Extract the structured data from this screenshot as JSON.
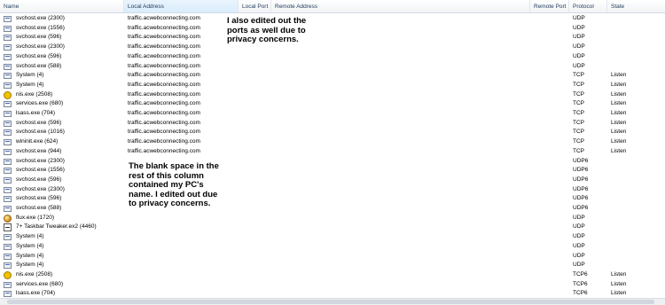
{
  "headers": {
    "name": "Name",
    "local_address": "Local Address",
    "local_port": "Local Port",
    "remote_address": "Remote Address",
    "remote_port": "Remote Port",
    "protocol": "Protocol",
    "state": "State"
  },
  "rows": [
    {
      "icon": "generic",
      "name": "svchost.exe (2300)",
      "addr": "traffic.acwebconnecting.com",
      "proto": "UDP",
      "state": ""
    },
    {
      "icon": "generic",
      "name": "svchost.exe (1556)",
      "addr": "traffic.acwebconnecting.com",
      "proto": "UDP",
      "state": ""
    },
    {
      "icon": "generic",
      "name": "svchost.exe (596)",
      "addr": "traffic.acwebconnecting.com",
      "proto": "UDP",
      "state": ""
    },
    {
      "icon": "generic",
      "name": "svchost.exe (2300)",
      "addr": "traffic.acwebconnecting.com",
      "proto": "UDP",
      "state": ""
    },
    {
      "icon": "generic",
      "name": "svchost.exe (596)",
      "addr": "traffic.acwebconnecting.com",
      "proto": "UDP",
      "state": ""
    },
    {
      "icon": "generic",
      "name": "svchost.exe (588)",
      "addr": "traffic.acwebconnecting.com",
      "proto": "UDP",
      "state": ""
    },
    {
      "icon": "generic",
      "name": "System (4)",
      "addr": "traffic.acwebconnecting.com",
      "proto": "TCP",
      "state": "Listen"
    },
    {
      "icon": "generic",
      "name": "System (4)",
      "addr": "traffic.acwebconnecting.com",
      "proto": "TCP",
      "state": "Listen"
    },
    {
      "icon": "nis",
      "name": "nis.exe (2508)",
      "addr": "traffic.acwebconnecting.com",
      "proto": "TCP",
      "state": "Listen"
    },
    {
      "icon": "generic",
      "name": "services.exe (680)",
      "addr": "traffic.acwebconnecting.com",
      "proto": "TCP",
      "state": "Listen"
    },
    {
      "icon": "generic",
      "name": "lsass.exe (704)",
      "addr": "traffic.acwebconnecting.com",
      "proto": "TCP",
      "state": "Listen"
    },
    {
      "icon": "generic",
      "name": "svchost.exe (596)",
      "addr": "traffic.acwebconnecting.com",
      "proto": "TCP",
      "state": "Listen"
    },
    {
      "icon": "generic",
      "name": "svchost.exe (1016)",
      "addr": "traffic.acwebconnecting.com",
      "proto": "TCP",
      "state": "Listen"
    },
    {
      "icon": "generic",
      "name": "wininit.exe (624)",
      "addr": "traffic.acwebconnecting.com",
      "proto": "TCP",
      "state": "Listen"
    },
    {
      "icon": "generic",
      "name": "svchost.exe (944)",
      "addr": "traffic.acwebconnecting.com",
      "proto": "TCP",
      "state": "Listen"
    },
    {
      "icon": "generic",
      "name": "svchost.exe (2300)",
      "addr": "",
      "proto": "UDP6",
      "state": ""
    },
    {
      "icon": "generic",
      "name": "svchost.exe (1556)",
      "addr": "",
      "proto": "UDP6",
      "state": ""
    },
    {
      "icon": "generic",
      "name": "svchost.exe (596)",
      "addr": "",
      "proto": "UDP6",
      "state": ""
    },
    {
      "icon": "generic",
      "name": "svchost.exe (2300)",
      "addr": "",
      "proto": "UDP6",
      "state": ""
    },
    {
      "icon": "generic",
      "name": "svchost.exe (596)",
      "addr": "",
      "proto": "UDP6",
      "state": ""
    },
    {
      "icon": "generic",
      "name": "svchost.exe (588)",
      "addr": "",
      "proto": "UDP6",
      "state": ""
    },
    {
      "icon": "flux",
      "name": "flux.exe (1720)",
      "addr": "",
      "proto": "UDP",
      "state": ""
    },
    {
      "icon": "tweaker",
      "name": "7+ Taskbar Tweaker.ex2 (4460)",
      "addr": "",
      "proto": "UDP",
      "state": ""
    },
    {
      "icon": "generic",
      "name": "System (4)",
      "addr": "",
      "proto": "UDP",
      "state": ""
    },
    {
      "icon": "generic",
      "name": "System (4)",
      "addr": "",
      "proto": "UDP",
      "state": ""
    },
    {
      "icon": "generic",
      "name": "System (4)",
      "addr": "",
      "proto": "UDP",
      "state": ""
    },
    {
      "icon": "generic",
      "name": "System (4)",
      "addr": "",
      "proto": "UDP",
      "state": ""
    },
    {
      "icon": "nis",
      "name": "nis.exe (2508)",
      "addr": "",
      "proto": "TCP6",
      "state": "Listen"
    },
    {
      "icon": "generic",
      "name": "services.exe (680)",
      "addr": "",
      "proto": "TCP6",
      "state": "Listen"
    },
    {
      "icon": "generic",
      "name": "lsass.exe (704)",
      "addr": "",
      "proto": "TCP6",
      "state": "Listen"
    }
  ],
  "notes": {
    "ports": "I also edited out the ports as well due to privacy concerns.",
    "blank": "The blank space in the rest of this column contained my PC's name.  I edited out due to privacy concerns."
  }
}
